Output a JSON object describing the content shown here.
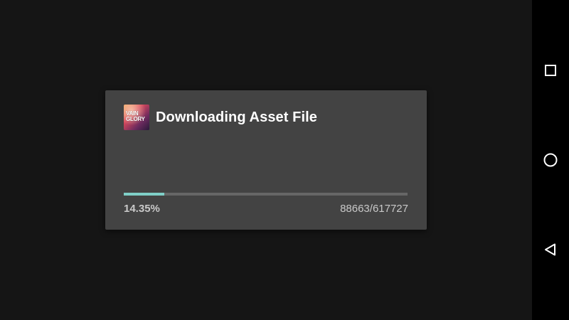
{
  "dialog": {
    "title": "Downloading Asset File",
    "icon": {
      "name": "vainglory-app-icon",
      "lettering": "VAIN GLORY"
    },
    "progress": {
      "fraction": 0.1435,
      "percent_label": "14.35%",
      "count_label": "88663/617727",
      "fill_color": "#7fcfc7",
      "track_color": "#666666"
    }
  },
  "nav_bar": {
    "buttons": [
      {
        "name": "recent-apps",
        "icon": "square-icon"
      },
      {
        "name": "home",
        "icon": "circle-icon"
      },
      {
        "name": "back",
        "icon": "triangle-back-icon"
      }
    ]
  },
  "colors": {
    "background": "#151515",
    "dialog": "#434343",
    "nav_bar": "#000000",
    "accent": "#7fcfc7"
  }
}
